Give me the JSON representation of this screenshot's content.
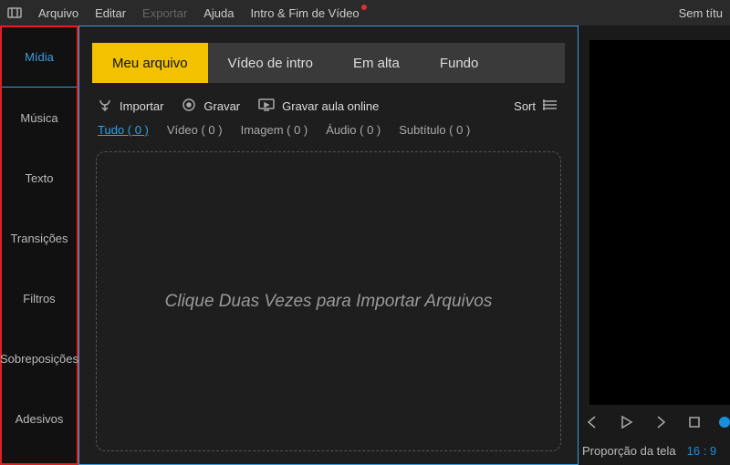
{
  "menu": {
    "items": [
      "Arquivo",
      "Editar",
      "Exportar",
      "Ajuda",
      "Intro & Fim de Vídeo"
    ],
    "disabled_index": 2,
    "dot_index": 4,
    "title": "Sem títu"
  },
  "sidebar": {
    "items": [
      "Mídia",
      "Música",
      "Texto",
      "Transições",
      "Filtros",
      "Sobreposições",
      "Adesivos"
    ],
    "active_index": 0
  },
  "tabs": {
    "items": [
      "Meu arquivo",
      "Vídeo de intro",
      "Em alta",
      "Fundo"
    ],
    "active_index": 0
  },
  "toolbar": {
    "import": "Importar",
    "record": "Gravar",
    "record_online": "Gravar aula online",
    "sort": "Sort"
  },
  "filters": {
    "items": [
      "Tudo ( 0 )",
      "Vídeo ( 0 )",
      "Imagem ( 0 )",
      "Áudio ( 0 )",
      "Subtítulo ( 0 )"
    ],
    "active_index": 0
  },
  "dropzone": {
    "text": "Clique Duas Vezes para Importar Arquivos"
  },
  "preview": {
    "ratio_label": "Proporção da tela",
    "ratio_value": "16 : 9"
  }
}
